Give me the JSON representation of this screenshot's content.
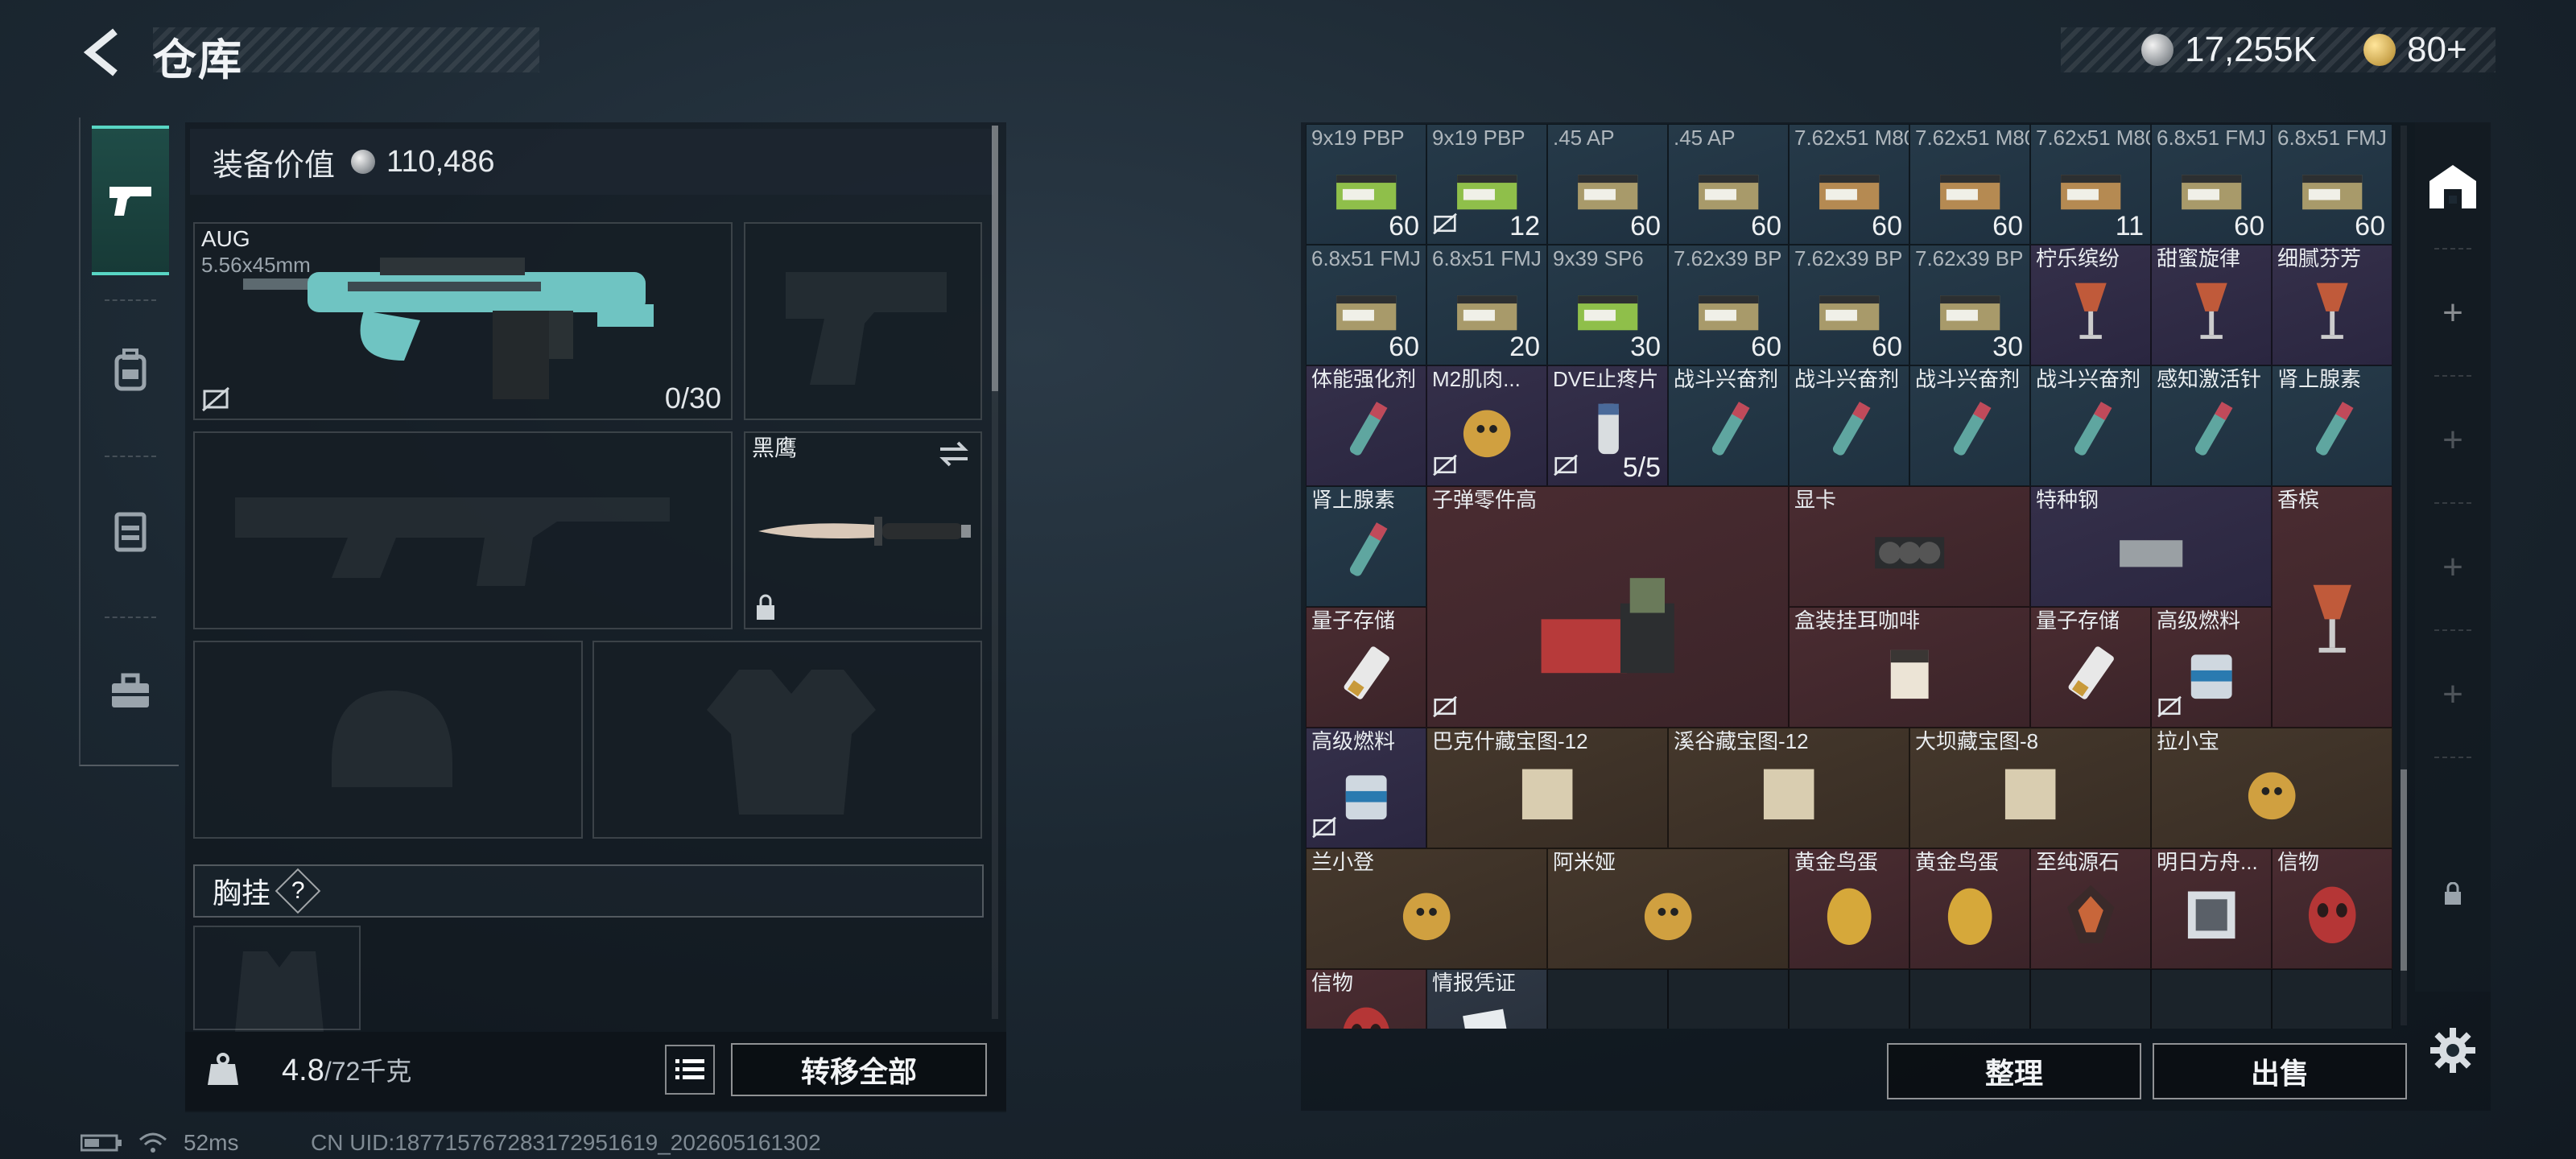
{
  "header": {
    "title": "仓库",
    "currency": [
      {
        "icon": "silver-coin-icon",
        "value": "17,255K"
      },
      {
        "icon": "gold-coin-icon",
        "value": "80+"
      }
    ]
  },
  "nav_tabs": [
    {
      "icon": "pistol-icon",
      "active": true
    },
    {
      "icon": "backpack-icon",
      "active": false
    },
    {
      "icon": "vest-icon",
      "active": false
    },
    {
      "icon": "briefcase-icon",
      "active": false
    }
  ],
  "equipment": {
    "value_label": "装备价值",
    "value": "110,486",
    "primary_weapon": {
      "name": "AUG",
      "caliber": "5.56x45mm",
      "ammo": "0/30"
    },
    "melee": {
      "name": "黑鹰"
    },
    "chest_rig_label": "胸挂",
    "help": "?"
  },
  "bottom_left": {
    "weight": "4.8",
    "weight_max": "/72千克",
    "transfer_all": "转移全部"
  },
  "storage": {
    "items": [
      {
        "name": "9x19 PBP",
        "qty": "60",
        "r": "blue"
      },
      {
        "name": "9x19 PBP",
        "qty": "12",
        "r": "blue"
      },
      {
        "name": ".45 AP",
        "qty": "60",
        "r": "blue"
      },
      {
        "name": ".45 AP",
        "qty": "60",
        "r": "blue"
      },
      {
        "name": "7.62x51 M80",
        "qty": "60",
        "r": "blue"
      },
      {
        "name": "7.62x51 M80",
        "qty": "60",
        "r": "blue"
      },
      {
        "name": "7.62x51 M80",
        "qty": "11",
        "r": "blue"
      },
      {
        "name": "6.8x51 FMJ",
        "qty": "60",
        "r": "blue"
      },
      {
        "name": "6.8x51 FMJ",
        "qty": "60",
        "r": "blue"
      },
      {
        "name": "6.8x51 FMJ",
        "qty": "60",
        "r": "blue"
      },
      {
        "name": "6.8x51 FMJ",
        "qty": "20",
        "r": "blue"
      },
      {
        "name": "9x39 SP6",
        "qty": "30",
        "r": "blue"
      },
      {
        "name": "7.62x39 BP",
        "qty": "60",
        "r": "blue"
      },
      {
        "name": "7.62x39 BP",
        "qty": "60",
        "r": "blue"
      },
      {
        "name": "7.62x39 BP",
        "qty": "30",
        "r": "blue"
      },
      {
        "name": "柠乐缤纷",
        "qty": "",
        "r": "purple"
      },
      {
        "name": "甜蜜旋律",
        "qty": "",
        "r": "purple"
      },
      {
        "name": "细腻芬芳",
        "qty": "",
        "r": "purple"
      },
      {
        "name": "体能强化剂",
        "qty": "",
        "r": "purple"
      },
      {
        "name": "M2肌肉...",
        "qty": "",
        "r": "purple"
      },
      {
        "name": "DVE止疼片",
        "qty": "5/5",
        "r": "purple"
      },
      {
        "name": "战斗兴奋剂",
        "qty": "",
        "r": "blue"
      },
      {
        "name": "战斗兴奋剂",
        "qty": "",
        "r": "blue"
      },
      {
        "name": "战斗兴奋剂",
        "qty": "",
        "r": "blue"
      },
      {
        "name": "战斗兴奋剂",
        "qty": "",
        "r": "blue"
      },
      {
        "name": "感知激活针",
        "qty": "",
        "r": "blue"
      },
      {
        "name": "肾上腺素",
        "qty": "",
        "r": "blue"
      },
      {
        "name": "肾上腺素",
        "qty": "",
        "r": "blue"
      },
      {
        "name": "子弹零件高",
        "qty": "",
        "r": "red"
      },
      {
        "name": "显卡",
        "qty": "",
        "r": "red"
      },
      {
        "name": "特种钢",
        "qty": "",
        "r": "purple"
      },
      {
        "name": "香槟",
        "qty": "",
        "r": "red"
      },
      {
        "name": "量子存储",
        "qty": "",
        "r": "red"
      },
      {
        "name": "盒装挂耳咖啡",
        "qty": "",
        "r": "red"
      },
      {
        "name": "量子存储",
        "qty": "",
        "r": "red"
      },
      {
        "name": "高级燃料",
        "qty": "",
        "r": "red"
      },
      {
        "name": "高级燃料",
        "qty": "",
        "r": "purple"
      },
      {
        "name": "巴克什藏宝图-12",
        "qty": "",
        "r": "gold"
      },
      {
        "name": "溪谷藏宝图-12",
        "qty": "",
        "r": "gold"
      },
      {
        "name": "大坝藏宝图-8",
        "qty": "",
        "r": "gold"
      },
      {
        "name": "拉小宝",
        "qty": "",
        "r": "gold"
      },
      {
        "name": "兰小登",
        "qty": "",
        "r": "gold"
      },
      {
        "name": "阿米娅",
        "qty": "",
        "r": "gold"
      },
      {
        "name": "黄金鸟蛋",
        "qty": "",
        "r": "red"
      },
      {
        "name": "黄金鸟蛋",
        "qty": "",
        "r": "red"
      },
      {
        "name": "至纯源石",
        "qty": "",
        "r": "red"
      },
      {
        "name": "明日方舟...",
        "qty": "",
        "r": "red"
      },
      {
        "name": "信物",
        "qty": "",
        "r": "red"
      },
      {
        "name": "信物",
        "qty": "",
        "r": "red"
      },
      {
        "name": "情报凭证",
        "qty": "",
        "r": "gray"
      }
    ]
  },
  "actions": {
    "organize": "整理",
    "sell": "出售"
  },
  "status": {
    "ping": "52ms",
    "uid": "CN UID:187715767283172951619_202605161302"
  },
  "colors": {
    "accent": "#58d6c4",
    "blue": "#263a49",
    "purple": "#35304a",
    "red": "#4a2c31",
    "gold": "#45382c"
  }
}
